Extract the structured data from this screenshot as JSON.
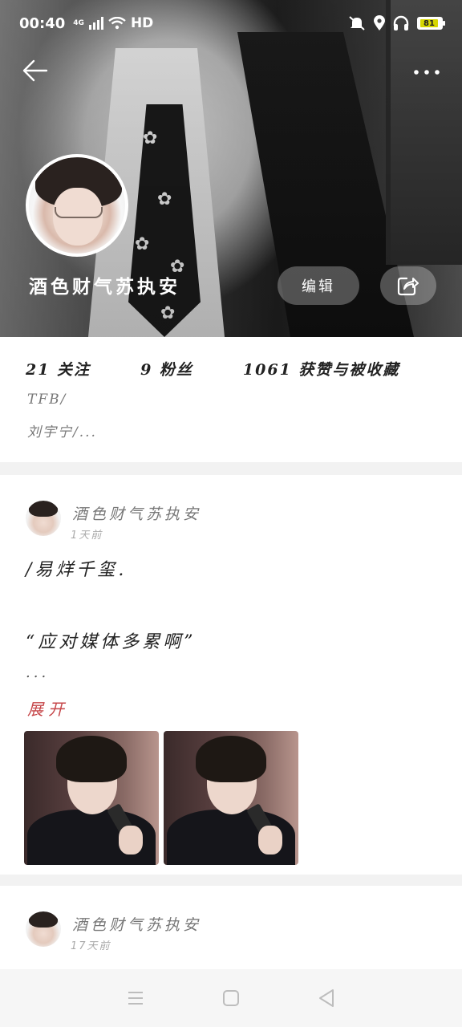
{
  "status_bar": {
    "time": "00:40",
    "network": "4G",
    "hd": "HD",
    "battery": "81",
    "icons": [
      "signal-icon",
      "wifi-icon",
      "mute-icon",
      "location-icon",
      "headphones-icon",
      "battery-icon"
    ]
  },
  "profile": {
    "nickname": "酒色财气苏执安",
    "edit_label": "编辑",
    "following": "21 关注",
    "followers": "9 粉丝",
    "likes": "1061 获赞与被收藏",
    "bio_lines": [
      "TFB/",
      "刘宇宁/..."
    ]
  },
  "posts": [
    {
      "author": "酒色财气苏执安",
      "time": "1天前",
      "lines": [
        "/易烊千玺.",
        "“应对媒体多累啊”",
        "..."
      ],
      "expand_label": "展开",
      "image_count": 2
    },
    {
      "author": "酒色财气苏执安",
      "time": "17天前"
    }
  ],
  "colors": {
    "accent": "#c6474a",
    "battery": "#d6d600"
  }
}
